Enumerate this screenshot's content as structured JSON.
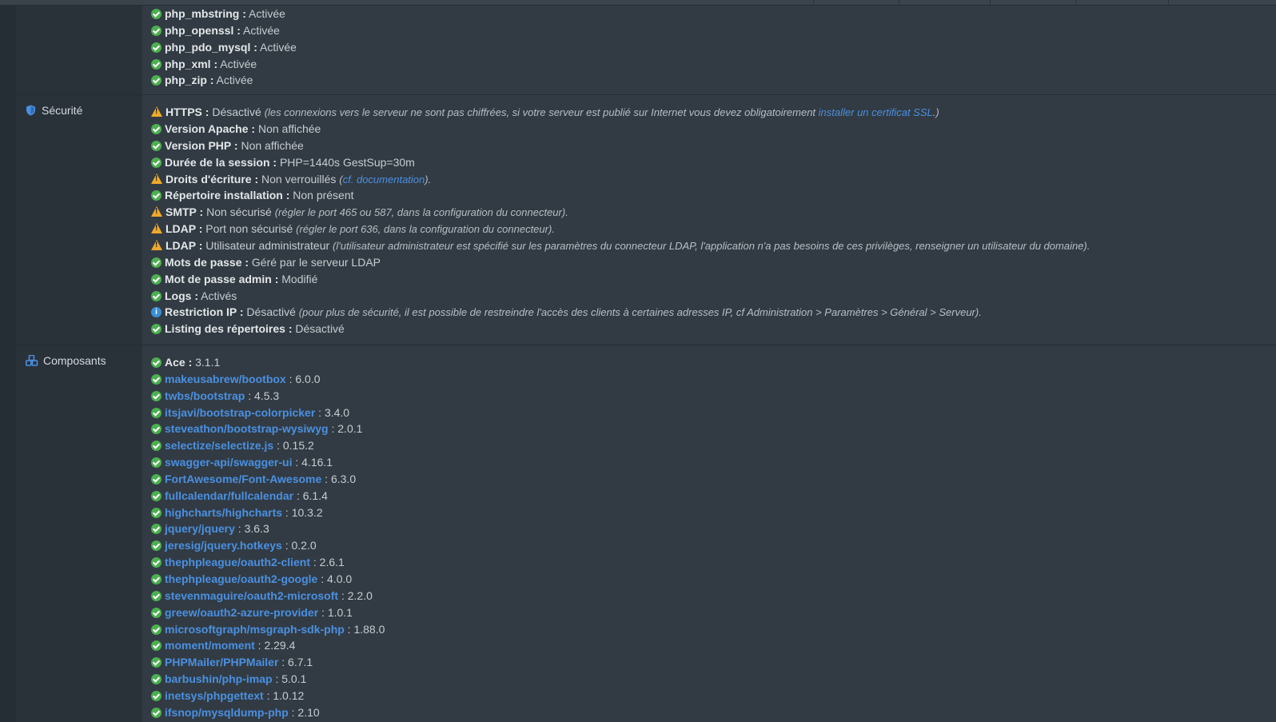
{
  "colors": {
    "ok": "#4caf50",
    "warn": "#f0a92a",
    "info": "#3a8fd6",
    "link": "#4a90e2"
  },
  "php_modules": [
    {
      "status": "ok",
      "key": "php_mbstring :",
      "value": " Activée"
    },
    {
      "status": "ok",
      "key": "php_openssl :",
      "value": " Activée"
    },
    {
      "status": "ok",
      "key": "php_pdo_mysql :",
      "value": " Activée"
    },
    {
      "status": "ok",
      "key": "php_xml :",
      "value": " Activée"
    },
    {
      "status": "ok",
      "key": "php_zip :",
      "value": " Activée"
    }
  ],
  "security": {
    "label": "Sécurité",
    "icon": "shield-icon",
    "items": [
      {
        "status": "warn",
        "key": "HTTPS :",
        "value": " Désactivé ",
        "note_pre": "(les connexions vers le serveur ne sont pas chiffrées, si votre serveur est publié sur Internet vous devez obligatoirement ",
        "note_link": "installer un certificat SSL",
        "note_post": ".)"
      },
      {
        "status": "ok",
        "key": "Version Apache :",
        "value": " Non affichée"
      },
      {
        "status": "ok",
        "key": "Version PHP :",
        "value": " Non affichée"
      },
      {
        "status": "ok",
        "key": "Durée de la session :",
        "value": " PHP=1440s GestSup=30m"
      },
      {
        "status": "warn",
        "key": "Droits d'écriture :",
        "value": " Non verrouillés ",
        "note_pre": "(",
        "note_link": "cf. documentation",
        "note_post": ")."
      },
      {
        "status": "ok",
        "key": "Répertoire installation :",
        "value": " Non présent"
      },
      {
        "status": "warn",
        "key": "SMTP :",
        "value": " Non sécurisé ",
        "note_pre": "(régler le port 465 ou 587, dans la configuration du connecteur)."
      },
      {
        "status": "warn",
        "key": "LDAP :",
        "value": " Port non sécurisé ",
        "note_pre": "(régler le port 636, dans la configuration du connecteur)."
      },
      {
        "status": "warn",
        "key": "LDAP :",
        "value": " Utilisateur administrateur ",
        "note_pre": "(l'utilisateur administrateur est spécifié sur les paramètres du connecteur LDAP, l'application n'a pas besoins de ces privilèges, renseigner un utilisateur du domaine)."
      },
      {
        "status": "ok",
        "key": "Mots de passe :",
        "value": " Géré par le serveur LDAP"
      },
      {
        "status": "ok",
        "key": "Mot de passe admin :",
        "value": " Modifié"
      },
      {
        "status": "ok",
        "key": "Logs :",
        "value": " Activés"
      },
      {
        "status": "info",
        "key": "Restriction IP :",
        "value": " Désactivé ",
        "note_pre": "(pour plus de sécurité, il est possible de restreindre l'accès des clients à certaines adresses IP, cf Administration > Paramètres > Général > Serveur)."
      },
      {
        "status": "ok",
        "key": "Listing des répertoires :",
        "value": " Désactivé"
      }
    ]
  },
  "components": {
    "label": "Composants",
    "icon": "cubes-icon",
    "first": {
      "key": "Ace :",
      "value": " 3.1.1"
    },
    "items": [
      {
        "name": "makeusabrew/bootbox",
        "version": " : 6.0.0"
      },
      {
        "name": "twbs/bootstrap",
        "version": " : 4.5.3"
      },
      {
        "name": "itsjavi/bootstrap-colorpicker",
        "version": " : 3.4.0"
      },
      {
        "name": "steveathon/bootstrap-wysiwyg",
        "version": " : 2.0.1"
      },
      {
        "name": "selectize/selectize.js",
        "version": " : 0.15.2"
      },
      {
        "name": "swagger-api/swagger-ui",
        "version": " : 4.16.1"
      },
      {
        "name": "FortAwesome/Font-Awesome",
        "version": " : 6.3.0"
      },
      {
        "name": "fullcalendar/fullcalendar",
        "version": " : 6.1.4"
      },
      {
        "name": "highcharts/highcharts",
        "version": " : 10.3.2"
      },
      {
        "name": "jquery/jquery",
        "version": " : 3.6.3"
      },
      {
        "name": "jeresig/jquery.hotkeys",
        "version": " : 0.2.0"
      },
      {
        "name": "thephpleague/oauth2-client",
        "version": " : 2.6.1"
      },
      {
        "name": "thephpleague/oauth2-google",
        "version": " : 4.0.0"
      },
      {
        "name": "stevenmaguire/oauth2-microsoft",
        "version": " : 2.2.0"
      },
      {
        "name": "greew/oauth2-azure-provider",
        "version": " : 1.0.1"
      },
      {
        "name": "microsoftgraph/msgraph-sdk-php",
        "version": " : 1.88.0"
      },
      {
        "name": "moment/moment",
        "version": " : 2.29.4"
      },
      {
        "name": "PHPMailer/PHPMailer",
        "version": " : 6.7.1"
      },
      {
        "name": "barbushin/php-imap",
        "version": " : 5.0.1"
      },
      {
        "name": "inetsys/phpgettext",
        "version": " : 1.0.12"
      },
      {
        "name": "ifsnop/mysqldump-php",
        "version": " : 2.10"
      }
    ]
  }
}
